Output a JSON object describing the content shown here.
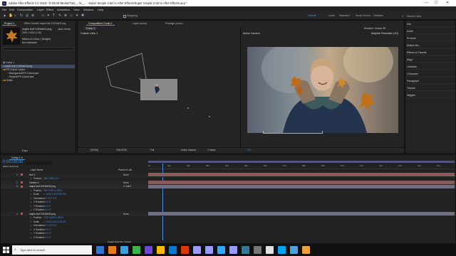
{
  "titlebar": {
    "title": "Adobe After Effects CC 2018 - E:\\DOD Media\\Tuts_...\\6_... - Super Simple 2.5D in After Effects\\Super Simple 2.5D in After Effects.aep *",
    "min": "—",
    "max": "☐",
    "close": "✕"
  },
  "menu": [
    "File",
    "Edit",
    "Composition",
    "Layer",
    "Effect",
    "Animation",
    "View",
    "Window",
    "Help"
  ],
  "toolbar": {
    "snapping": "Snapping",
    "workspaces": [
      "Default",
      "Learn",
      "Standard",
      "Small Screen",
      "Libraries"
    ],
    "search": "Search Help"
  },
  "project": {
    "tab_project": "Project ≡",
    "tab_effects": "Effect Controls maple leaf 3-9Cfde02.png",
    "asset_name": "maple leaf 3-9Cfde02.png",
    "asset_used": "used 4 times",
    "asset_dims": "1024 x 1024 (1.00)",
    "asset_colors": "Millions of Colors+ (Straight)",
    "asset_interp": "Non-Interlaced",
    "search_ph": "",
    "items": [
      "Comp 1",
      "maple leaf 3-9Cfde02.png",
      "PS Cutout Layers",
      "Background/PS Cutout.psd",
      "Subject/PS Cutout.psd",
      "Solids"
    ],
    "bpc": "8 bpc"
  },
  "comp": {
    "tab": "Composition Comp 1",
    "tab_layer": "Layer (none)",
    "tab_footage": "Footage (none)",
    "breadcrumb": "Comp 1",
    "view_left": "Custom View 1",
    "view_right": "Active Camera",
    "renderer": "Renderer: Classic 3D",
    "adaptive": "Adaptive Resolution (1/2)",
    "zoom": "(33.3%)",
    "time": "0:00:00:00",
    "res": "Full",
    "camera": "Active Camera",
    "views": "2 Views",
    "offset": "+0.0"
  },
  "right_panels": [
    "Info",
    "Audio",
    "Preview",
    "Motion Bro",
    "Effects & Presets",
    "Align",
    "Libraries",
    "Character",
    "Paragraph",
    "Tracker",
    "Wiggler"
  ],
  "timeline": {
    "tab": "Comp 1 ≡",
    "timecode": "0:00:00:00",
    "fps": "00000 (25.00 fps)",
    "col_name": "Layer Name",
    "col_parent": "Parent & Link",
    "ruler": [
      "0s",
      "01s",
      "02s",
      "03s",
      "04s",
      "05s",
      "06s",
      "07s",
      "08s",
      "09s",
      "10s",
      "11s",
      "12s",
      "13s",
      "14s",
      "15s"
    ],
    "rows": [
      {
        "num": "1",
        "name": "Null 1",
        "parent": "None",
        "kind": "layer",
        "color": "#c85050"
      },
      {
        "name": "Position",
        "val": "960.0,540.0,0.0",
        "kind": "prop"
      },
      {
        "num": "2",
        "name": "Camera 1",
        "parent": "None",
        "kind": "layer",
        "color": "#c85050"
      },
      {
        "num": "3",
        "name": "maple leaf 3-9Cfde02.png",
        "parent": "1. Null 1",
        "kind": "layer",
        "color": "#c85050"
      },
      {
        "name": "Position",
        "val": "390.0,391.0,-908.1",
        "kind": "prop"
      },
      {
        "name": "Scale",
        "val": "∞ 100.0,100.0,100.0%",
        "kind": "prop"
      },
      {
        "name": "Orientation",
        "val": "0.0°,0.0°,0.0°",
        "kind": "prop"
      },
      {
        "name": "X Rotation",
        "val": "0x+0.0°",
        "kind": "prop"
      },
      {
        "name": "Y Rotation",
        "val": "0x+0.0°",
        "kind": "prop"
      },
      {
        "name": "Z Rotation",
        "val": "0x+0.0°",
        "kind": "prop"
      },
      {
        "num": "4",
        "name": "maple leaf 3-9Cfde02.png",
        "parent": "None",
        "kind": "layer",
        "color": "#c85050"
      },
      {
        "name": "Position",
        "val": "1142.0,380.0,-869.0",
        "kind": "prop"
      },
      {
        "name": "Scale",
        "val": "∞ 100.0,100.0,100.0%",
        "kind": "prop"
      },
      {
        "name": "Orientation",
        "val": "0.0°,0.0°,0.0°",
        "kind": "prop"
      },
      {
        "name": "X Rotation",
        "val": "0x+0.0°",
        "kind": "prop"
      },
      {
        "name": "Y Rotation",
        "val": "0x+0.0°",
        "kind": "prop"
      },
      {
        "name": "Z Rotation",
        "val": "0x+0.0°",
        "kind": "prop"
      }
    ],
    "toggle": "Toggle Switches / Modes"
  },
  "taskbar": {
    "search_ph": "Type here to search",
    "time": "",
    "apps": [
      "#2b78d6",
      "#e87a1f",
      "#39a0e0",
      "#3bb54a",
      "#6b49d6",
      "#ffb900",
      "#0078d7",
      "#d83b01",
      "#9999ff",
      "#9999ff",
      "#31a8ff",
      "#9999ff",
      "#2d7d9a",
      "#777",
      "#e0e0e0",
      "#00a4ef",
      "#4aa3df",
      "#e9a23b"
    ]
  }
}
